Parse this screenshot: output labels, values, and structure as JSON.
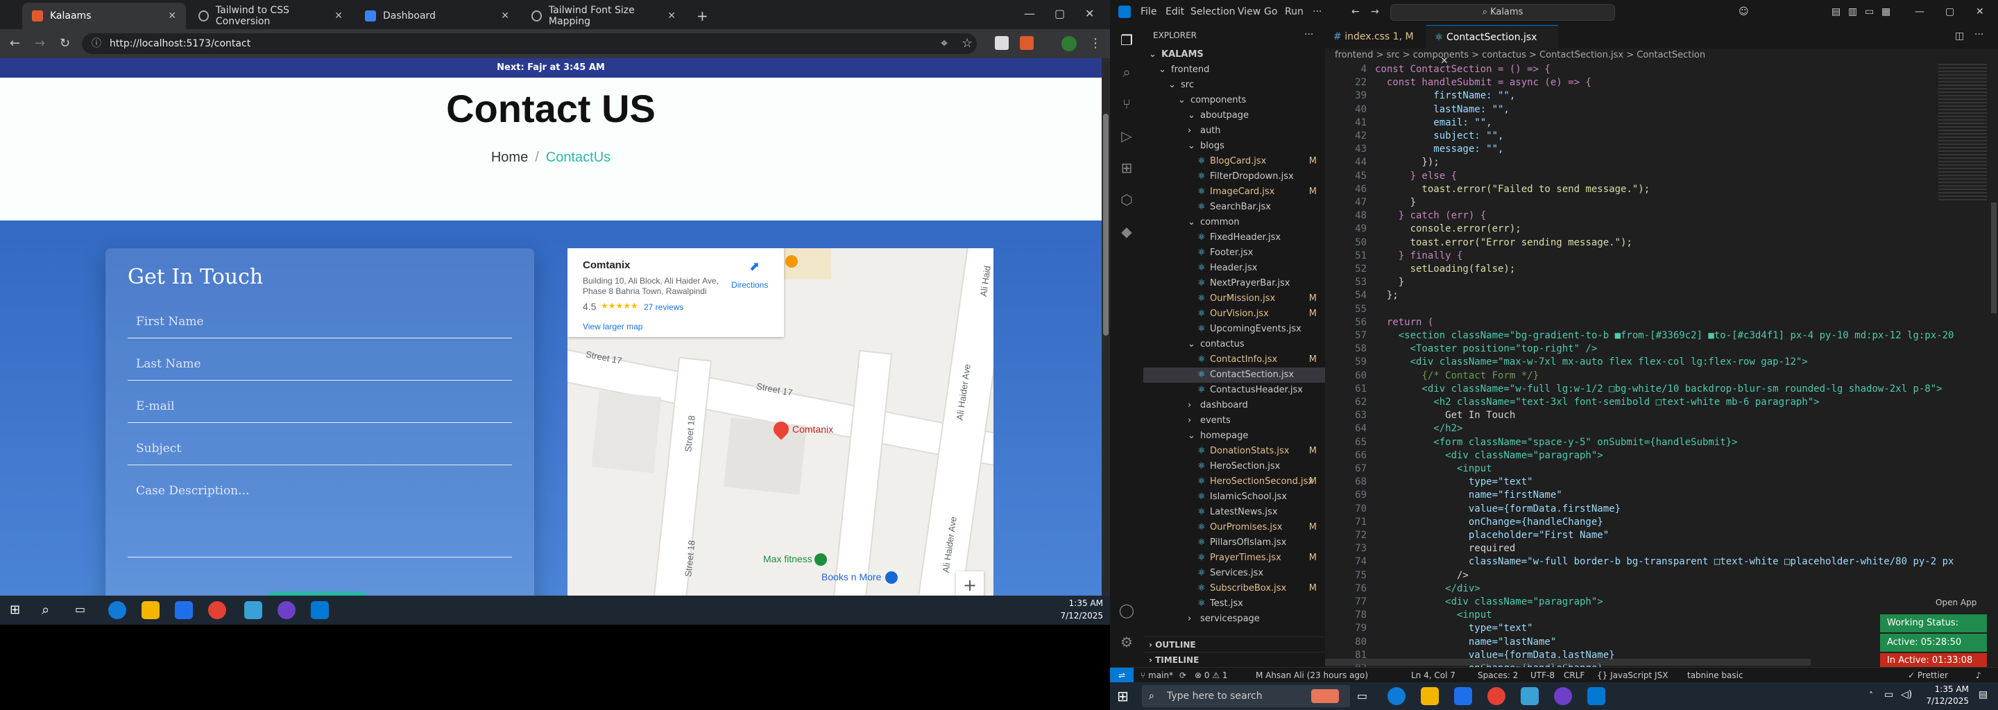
{
  "browser": {
    "tabs": [
      {
        "label": "Kalaams",
        "color": "#e05a2b"
      },
      {
        "label": "Tailwind to CSS Conversion",
        "color": "#444"
      },
      {
        "label": "Dashboard",
        "color": "#3b82f6"
      },
      {
        "label": "Tailwind Font Size Mapping",
        "color": "#444"
      }
    ],
    "new_tab": "+",
    "url": "http://localhost:5173/contact"
  },
  "page": {
    "announcement": "Next: Fajr at 3:45 AM",
    "title": "Contact US",
    "breadcrumb_home": "Home",
    "breadcrumb_sep": "/",
    "breadcrumb_current": "ContactUs",
    "form": {
      "heading": "Get In Touch",
      "first_name": "First Name",
      "last_name": "Last Name",
      "email": "E-mail",
      "subject": "Subject",
      "description": "Case Description..."
    },
    "map": {
      "place_name": "Comtanix",
      "address": "Building 10, Ali Block, Ali Haider Ave, Phase 8 Bahria Town, Rawalpindi",
      "rating": "4.5",
      "stars": "★★★★★",
      "reviews": "27 reviews",
      "directions": "Directions",
      "larger_map": "View larger map",
      "street1": "Street 17",
      "street2": "Street 17",
      "street3": "Street 18",
      "street4": "Street 18",
      "avenue1": "Ali Haider Ave",
      "avenue2": "Ali Haider Ave",
      "avenue3": "Ali Haid",
      "pin_label": "Comtanix",
      "poi1": "Max fitness",
      "poi2": "Books n More",
      "zoom": "+"
    }
  },
  "left_taskbar": {
    "time": "1:35 AM",
    "date": "7/12/2025"
  },
  "vscode": {
    "menus": [
      "File",
      "Edit",
      "Selection",
      "View",
      "Go",
      "Run",
      "···"
    ],
    "search": "Kalams",
    "explorer_title": "EXPLORER",
    "open_app": "Open App",
    "tree": [
      {
        "label": "KALAMS",
        "indent": 0,
        "type": "root"
      },
      {
        "label": "frontend",
        "indent": 1,
        "type": "folder"
      },
      {
        "label": "src",
        "indent": 2,
        "type": "folder"
      },
      {
        "label": "components",
        "indent": 3,
        "type": "folder"
      },
      {
        "label": "aboutpage",
        "indent": 4,
        "type": "folder"
      },
      {
        "label": "auth",
        "indent": 4,
        "type": "folder-closed"
      },
      {
        "label": "blogs",
        "indent": 4,
        "type": "folder"
      },
      {
        "label": "BlogCard.jsx",
        "indent": 5,
        "type": "file",
        "mod": "M"
      },
      {
        "label": "FilterDropdown.jsx",
        "indent": 5,
        "type": "file",
        "mod": ""
      },
      {
        "label": "ImageCard.jsx",
        "indent": 5,
        "type": "file",
        "mod": "M"
      },
      {
        "label": "SearchBar.jsx",
        "indent": 5,
        "type": "file",
        "mod": ""
      },
      {
        "label": "common",
        "indent": 4,
        "type": "folder"
      },
      {
        "label": "FixedHeader.jsx",
        "indent": 5,
        "type": "file",
        "mod": ""
      },
      {
        "label": "Footer.jsx",
        "indent": 5,
        "type": "file",
        "mod": ""
      },
      {
        "label": "Header.jsx",
        "indent": 5,
        "type": "file",
        "mod": ""
      },
      {
        "label": "NextPrayerBar.jsx",
        "indent": 5,
        "type": "file",
        "mod": ""
      },
      {
        "label": "OurMission.jsx",
        "indent": 5,
        "type": "file",
        "mod": "M"
      },
      {
        "label": "OurVision.jsx",
        "indent": 5,
        "type": "file",
        "mod": "M"
      },
      {
        "label": "UpcomingEvents.jsx",
        "indent": 5,
        "type": "file",
        "mod": ""
      },
      {
        "label": "contactus",
        "indent": 4,
        "type": "folder"
      },
      {
        "label": "ContactInfo.jsx",
        "indent": 5,
        "type": "file",
        "mod": "M"
      },
      {
        "label": "ContactSection.jsx",
        "indent": 5,
        "type": "file",
        "mod": "",
        "sel": true
      },
      {
        "label": "ContactusHeader.jsx",
        "indent": 5,
        "type": "file",
        "mod": ""
      },
      {
        "label": "dashboard",
        "indent": 4,
        "type": "folder-closed"
      },
      {
        "label": "events",
        "indent": 4,
        "type": "folder-closed"
      },
      {
        "label": "homepage",
        "indent": 4,
        "type": "folder"
      },
      {
        "label": "DonationStats.jsx",
        "indent": 5,
        "type": "file",
        "mod": "M"
      },
      {
        "label": "HeroSection.jsx",
        "indent": 5,
        "type": "file",
        "mod": ""
      },
      {
        "label": "HeroSectionSecond.jsx",
        "indent": 5,
        "type": "file",
        "mod": "M"
      },
      {
        "label": "IslamicSchool.jsx",
        "indent": 5,
        "type": "file",
        "mod": ""
      },
      {
        "label": "LatestNews.jsx",
        "indent": 5,
        "type": "file",
        "mod": ""
      },
      {
        "label": "OurPromises.jsx",
        "indent": 5,
        "type": "file",
        "mod": "M"
      },
      {
        "label": "PillarsOfIslam.jsx",
        "indent": 5,
        "type": "file",
        "mod": ""
      },
      {
        "label": "PrayerTimes.jsx",
        "indent": 5,
        "type": "file",
        "mod": "M"
      },
      {
        "label": "Services.jsx",
        "indent": 5,
        "type": "file",
        "mod": ""
      },
      {
        "label": "SubscribeBox.jsx",
        "indent": 5,
        "type": "file",
        "mod": "M"
      },
      {
        "label": "Test.jsx",
        "indent": 5,
        "type": "file",
        "mod": ""
      },
      {
        "label": "servicespage",
        "indent": 4,
        "type": "folder-closed"
      }
    ],
    "outline": "OUTLINE",
    "timeline": "TIMELINE",
    "editor_tabs": [
      {
        "label": "index.css 1, M",
        "active": false
      },
      {
        "label": "ContactSection.jsx",
        "active": true
      }
    ],
    "breadcrumb": "frontend > src > components > contactus > ContactSection.jsx > ContactSection",
    "code": [
      {
        "n": "4",
        "t": "const ContactSection = () => {"
      },
      {
        "n": "22",
        "t": "  const handleSubmit = async (e) => {"
      },
      {
        "n": "39",
        "t": "          firstName: \"\","
      },
      {
        "n": "40",
        "t": "          lastName: \"\","
      },
      {
        "n": "41",
        "t": "          email: \"\","
      },
      {
        "n": "42",
        "t": "          subject: \"\","
      },
      {
        "n": "43",
        "t": "          message: \"\","
      },
      {
        "n": "44",
        "t": "        });"
      },
      {
        "n": "45",
        "t": "      } else {"
      },
      {
        "n": "46",
        "t": "        toast.error(\"Failed to send message.\");"
      },
      {
        "n": "47",
        "t": "      }"
      },
      {
        "n": "48",
        "t": "    } catch (err) {"
      },
      {
        "n": "49",
        "t": "      console.error(err);"
      },
      {
        "n": "50",
        "t": "      toast.error(\"Error sending message.\");"
      },
      {
        "n": "51",
        "t": "    } finally {"
      },
      {
        "n": "52",
        "t": "      setLoading(false);"
      },
      {
        "n": "53",
        "t": "    }"
      },
      {
        "n": "54",
        "t": "  };"
      },
      {
        "n": "55",
        "t": ""
      },
      {
        "n": "56",
        "t": "  return ("
      },
      {
        "n": "57",
        "t": "    <section className=\"bg-gradient-to-b ■from-[#3369c2] ■to-[#c3d4f1] px-4 py-10 md:px-12 lg:px-20"
      },
      {
        "n": "58",
        "t": "      <Toaster position=\"top-right\" />"
      },
      {
        "n": "59",
        "t": "      <div className=\"max-w-7xl mx-auto flex flex-col lg:flex-row gap-12\">"
      },
      {
        "n": "60",
        "t": "        {/* Contact Form */}"
      },
      {
        "n": "61",
        "t": "        <div className=\"w-full lg:w-1/2 □bg-white/10 backdrop-blur-sm rounded-lg shadow-2xl p-8\">"
      },
      {
        "n": "62",
        "t": "          <h2 className=\"text-3xl font-semibold □text-white mb-6 paragraph\">"
      },
      {
        "n": "63",
        "t": "            Get In Touch"
      },
      {
        "n": "64",
        "t": "          </h2>"
      },
      {
        "n": "65",
        "t": "          <form className=\"space-y-5\" onSubmit={handleSubmit}>"
      },
      {
        "n": "66",
        "t": "            <div className=\"paragraph\">"
      },
      {
        "n": "67",
        "t": "              <input"
      },
      {
        "n": "68",
        "t": "                type=\"text\""
      },
      {
        "n": "69",
        "t": "                name=\"firstName\""
      },
      {
        "n": "70",
        "t": "                value={formData.firstName}"
      },
      {
        "n": "71",
        "t": "                onChange={handleChange}"
      },
      {
        "n": "72",
        "t": "                placeholder=\"First Name\""
      },
      {
        "n": "73",
        "t": "                required"
      },
      {
        "n": "74",
        "t": "                className=\"w-full border-b bg-transparent □text-white □placeholder-white/80 py-2 px"
      },
      {
        "n": "75",
        "t": "              />"
      },
      {
        "n": "76",
        "t": "            </div>"
      },
      {
        "n": "77",
        "t": "            <div className=\"paragraph\">"
      },
      {
        "n": "78",
        "t": "              <input"
      },
      {
        "n": "79",
        "t": "                type=\"text\""
      },
      {
        "n": "80",
        "t": "                name=\"lastName\""
      },
      {
        "n": "81",
        "t": "                value={formData.lastName}"
      },
      {
        "n": "82",
        "t": "                onChange={handleChange}"
      }
    ],
    "status": {
      "branch": "main*",
      "sync": "⟳",
      "problems": "⊗ 0 ⚠ 1",
      "author": "M Ahsan Ali (23 hours ago)",
      "position": "Ln 4, Col 7",
      "spaces": "Spaces: 2",
      "encoding": "UTF-8",
      "eol": "CRLF",
      "language": "{} JavaScript JSX",
      "tabnine": "tabnine basic",
      "prettier": "✓ Prettier"
    },
    "working_status": "Working Status: Active",
    "active_time": "Active: 05:28:50",
    "inactive_time": "In Active: 01:33:08"
  },
  "right_taskbar": {
    "search_placeholder": "Type here to search",
    "time": "1:35 AM",
    "date": "7/12/2025"
  },
  "colors": {
    "accent_teal": "#2bb7a5",
    "gradient_from": "#3369c2",
    "vscode_blue": "#0078d4",
    "badge_green": "#1f8b4c",
    "badge_red": "#c42b1c"
  }
}
